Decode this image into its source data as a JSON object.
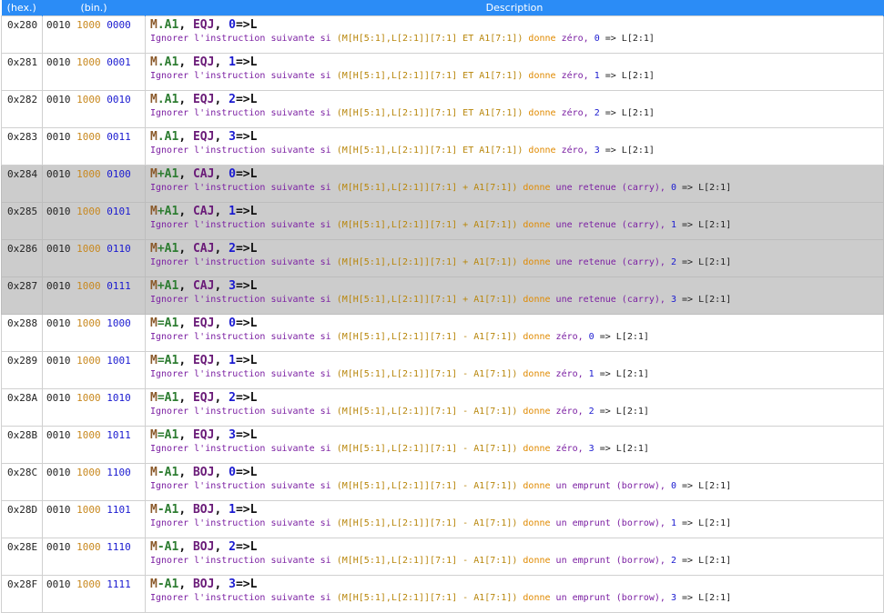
{
  "header": {
    "hex_label": "(hex.)",
    "bin_label": "(bin.)",
    "desc_label": "Description"
  },
  "rows": [
    {
      "hex": "0x280",
      "b1": "0010",
      "b2": "1000",
      "b3": "0000",
      "m": "M",
      "op": ".",
      "a1": "A1",
      "sep": ", ",
      "cmd": "EQJ",
      "sep2": ", ",
      "imm": "0",
      "arrow": "=>L",
      "desc_pre": "Ignorer l'instruction suivante si ",
      "expr": "(M[H[5:1],L[2:1]][7:1] ET A1[7:1])",
      "gives": " donne ",
      "result": "zéro, ",
      "imm2": "0",
      "dst2": " => L[2:1]",
      "highlight": false
    },
    {
      "hex": "0x281",
      "b1": "0010",
      "b2": "1000",
      "b3": "0001",
      "m": "M",
      "op": ".",
      "a1": "A1",
      "sep": ", ",
      "cmd": "EQJ",
      "sep2": ", ",
      "imm": "1",
      "arrow": "=>L",
      "desc_pre": "Ignorer l'instruction suivante si ",
      "expr": "(M[H[5:1],L[2:1]][7:1] ET A1[7:1])",
      "gives": " donne ",
      "result": "zéro, ",
      "imm2": "1",
      "dst2": " => L[2:1]",
      "highlight": false
    },
    {
      "hex": "0x282",
      "b1": "0010",
      "b2": "1000",
      "b3": "0010",
      "m": "M",
      "op": ".",
      "a1": "A1",
      "sep": ", ",
      "cmd": "EQJ",
      "sep2": ", ",
      "imm": "2",
      "arrow": "=>L",
      "desc_pre": "Ignorer l'instruction suivante si ",
      "expr": "(M[H[5:1],L[2:1]][7:1] ET A1[7:1])",
      "gives": " donne ",
      "result": "zéro, ",
      "imm2": "2",
      "dst2": " => L[2:1]",
      "highlight": false
    },
    {
      "hex": "0x283",
      "b1": "0010",
      "b2": "1000",
      "b3": "0011",
      "m": "M",
      "op": ".",
      "a1": "A1",
      "sep": ", ",
      "cmd": "EQJ",
      "sep2": ", ",
      "imm": "3",
      "arrow": "=>L",
      "desc_pre": "Ignorer l'instruction suivante si ",
      "expr": "(M[H[5:1],L[2:1]][7:1] ET A1[7:1])",
      "gives": " donne ",
      "result": "zéro, ",
      "imm2": "3",
      "dst2": " => L[2:1]",
      "highlight": false
    },
    {
      "hex": "0x284",
      "b1": "0010",
      "b2": "1000",
      "b3": "0100",
      "m": "M",
      "op": "+",
      "a1": "A1",
      "sep": ", ",
      "cmd": "CAJ",
      "sep2": ", ",
      "imm": "0",
      "arrow": "=>L",
      "desc_pre": "Ignorer l'instruction suivante si ",
      "expr": "(M[H[5:1],L[2:1]][7:1] + A1[7:1])",
      "gives": " donne ",
      "result": "une retenue (carry), ",
      "imm2": "0",
      "dst2": " => L[2:1]",
      "highlight": true
    },
    {
      "hex": "0x285",
      "b1": "0010",
      "b2": "1000",
      "b3": "0101",
      "m": "M",
      "op": "+",
      "a1": "A1",
      "sep": ", ",
      "cmd": "CAJ",
      "sep2": ", ",
      "imm": "1",
      "arrow": "=>L",
      "desc_pre": "Ignorer l'instruction suivante si ",
      "expr": "(M[H[5:1],L[2:1]][7:1] + A1[7:1])",
      "gives": " donne ",
      "result": "une retenue (carry), ",
      "imm2": "1",
      "dst2": " => L[2:1]",
      "highlight": true
    },
    {
      "hex": "0x286",
      "b1": "0010",
      "b2": "1000",
      "b3": "0110",
      "m": "M",
      "op": "+",
      "a1": "A1",
      "sep": ", ",
      "cmd": "CAJ",
      "sep2": ", ",
      "imm": "2",
      "arrow": "=>L",
      "desc_pre": "Ignorer l'instruction suivante si ",
      "expr": "(M[H[5:1],L[2:1]][7:1] + A1[7:1])",
      "gives": " donne ",
      "result": "une retenue (carry), ",
      "imm2": "2",
      "dst2": " => L[2:1]",
      "highlight": true
    },
    {
      "hex": "0x287",
      "b1": "0010",
      "b2": "1000",
      "b3": "0111",
      "m": "M",
      "op": "+",
      "a1": "A1",
      "sep": ", ",
      "cmd": "CAJ",
      "sep2": ", ",
      "imm": "3",
      "arrow": "=>L",
      "desc_pre": "Ignorer l'instruction suivante si ",
      "expr": "(M[H[5:1],L[2:1]][7:1] + A1[7:1])",
      "gives": " donne ",
      "result": "une retenue (carry), ",
      "imm2": "3",
      "dst2": " => L[2:1]",
      "highlight": true
    },
    {
      "hex": "0x288",
      "b1": "0010",
      "b2": "1000",
      "b3": "1000",
      "m": "M",
      "op": "=",
      "a1": "A1",
      "sep": ", ",
      "cmd": "EQJ",
      "sep2": ", ",
      "imm": "0",
      "arrow": "=>L",
      "desc_pre": "Ignorer l'instruction suivante si ",
      "expr": "(M[H[5:1],L[2:1]][7:1] - A1[7:1])",
      "gives": " donne ",
      "result": "zéro, ",
      "imm2": "0",
      "dst2": " => L[2:1]",
      "highlight": false
    },
    {
      "hex": "0x289",
      "b1": "0010",
      "b2": "1000",
      "b3": "1001",
      "m": "M",
      "op": "=",
      "a1": "A1",
      "sep": ", ",
      "cmd": "EQJ",
      "sep2": ", ",
      "imm": "1",
      "arrow": "=>L",
      "desc_pre": "Ignorer l'instruction suivante si ",
      "expr": "(M[H[5:1],L[2:1]][7:1] - A1[7:1])",
      "gives": " donne ",
      "result": "zéro, ",
      "imm2": "1",
      "dst2": " => L[2:1]",
      "highlight": false
    },
    {
      "hex": "0x28A",
      "b1": "0010",
      "b2": "1000",
      "b3": "1010",
      "m": "M",
      "op": "=",
      "a1": "A1",
      "sep": ", ",
      "cmd": "EQJ",
      "sep2": ", ",
      "imm": "2",
      "arrow": "=>L",
      "desc_pre": "Ignorer l'instruction suivante si ",
      "expr": "(M[H[5:1],L[2:1]][7:1] - A1[7:1])",
      "gives": " donne ",
      "result": "zéro, ",
      "imm2": "2",
      "dst2": " => L[2:1]",
      "highlight": false
    },
    {
      "hex": "0x28B",
      "b1": "0010",
      "b2": "1000",
      "b3": "1011",
      "m": "M",
      "op": "=",
      "a1": "A1",
      "sep": ", ",
      "cmd": "EQJ",
      "sep2": ", ",
      "imm": "3",
      "arrow": "=>L",
      "desc_pre": "Ignorer l'instruction suivante si ",
      "expr": "(M[H[5:1],L[2:1]][7:1] - A1[7:1])",
      "gives": " donne ",
      "result": "zéro, ",
      "imm2": "3",
      "dst2": " => L[2:1]",
      "highlight": false
    },
    {
      "hex": "0x28C",
      "b1": "0010",
      "b2": "1000",
      "b3": "1100",
      "m": "M",
      "op": "-",
      "a1": "A1",
      "sep": ", ",
      "cmd": "BOJ",
      "sep2": ", ",
      "imm": "0",
      "arrow": "=>L",
      "desc_pre": "Ignorer l'instruction suivante si ",
      "expr": "(M[H[5:1],L[2:1]][7:1] - A1[7:1])",
      "gives": " donne ",
      "result": "un emprunt (borrow), ",
      "imm2": "0",
      "dst2": " => L[2:1]",
      "highlight": false
    },
    {
      "hex": "0x28D",
      "b1": "0010",
      "b2": "1000",
      "b3": "1101",
      "m": "M",
      "op": "-",
      "a1": "A1",
      "sep": ", ",
      "cmd": "BOJ",
      "sep2": ", ",
      "imm": "1",
      "arrow": "=>L",
      "desc_pre": "Ignorer l'instruction suivante si ",
      "expr": "(M[H[5:1],L[2:1]][7:1] - A1[7:1])",
      "gives": " donne ",
      "result": "un emprunt (borrow), ",
      "imm2": "1",
      "dst2": " => L[2:1]",
      "highlight": false
    },
    {
      "hex": "0x28E",
      "b1": "0010",
      "b2": "1000",
      "b3": "1110",
      "m": "M",
      "op": "-",
      "a1": "A1",
      "sep": ", ",
      "cmd": "BOJ",
      "sep2": ", ",
      "imm": "2",
      "arrow": "=>L",
      "desc_pre": "Ignorer l'instruction suivante si ",
      "expr": "(M[H[5:1],L[2:1]][7:1] - A1[7:1])",
      "gives": " donne ",
      "result": "un emprunt (borrow), ",
      "imm2": "2",
      "dst2": " => L[2:1]",
      "highlight": false
    },
    {
      "hex": "0x28F",
      "b1": "0010",
      "b2": "1000",
      "b3": "1111",
      "m": "M",
      "op": "-",
      "a1": "A1",
      "sep": ", ",
      "cmd": "BOJ",
      "sep2": ", ",
      "imm": "3",
      "arrow": "=>L",
      "desc_pre": "Ignorer l'instruction suivante si ",
      "expr": "(M[H[5:1],L[2:1]][7:1] - A1[7:1])",
      "gives": " donne ",
      "result": "un emprunt (borrow), ",
      "imm2": "3",
      "dst2": " => L[2:1]",
      "highlight": false
    }
  ]
}
